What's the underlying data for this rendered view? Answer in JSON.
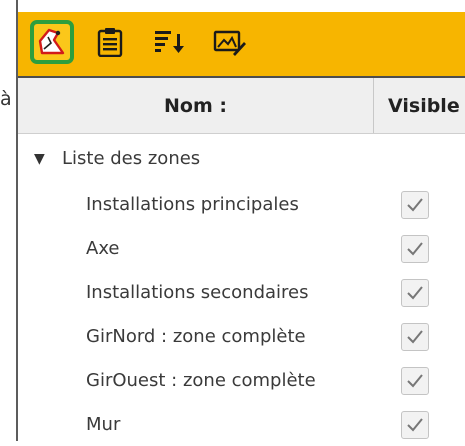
{
  "stray_char": "à",
  "toolbar": {
    "background": "#f7b500",
    "active_border": "#2e9e3e",
    "tools": [
      {
        "icon": "zone-polygon-icon",
        "active": true
      },
      {
        "icon": "clipboard-list-icon",
        "active": false
      },
      {
        "icon": "sort-down-icon",
        "active": false
      },
      {
        "icon": "image-edit-icon",
        "active": false
      }
    ]
  },
  "table": {
    "columns": {
      "name": "Nom :",
      "visible": "Visible"
    },
    "group": {
      "label": "Liste des zones",
      "expanded": true
    },
    "items": [
      {
        "label": "Installations principales",
        "visible": true
      },
      {
        "label": "Axe",
        "visible": true
      },
      {
        "label": "Installations secondaires",
        "visible": true
      },
      {
        "label": "GirNord : zone complète",
        "visible": true
      },
      {
        "label": "GirOuest : zone complète",
        "visible": true
      },
      {
        "label": "Mur",
        "visible": true
      }
    ]
  }
}
